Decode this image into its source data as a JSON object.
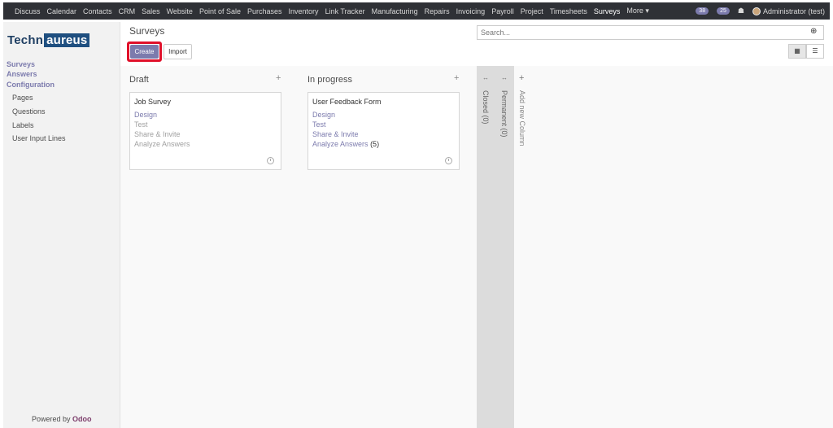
{
  "topbar": {
    "menu": [
      "Discuss",
      "Calendar",
      "Contacts",
      "CRM",
      "Sales",
      "Website",
      "Point of Sale",
      "Purchases",
      "Inventory",
      "Link Tracker",
      "Manufacturing",
      "Repairs",
      "Invoicing",
      "Payroll",
      "Project",
      "Timesheets",
      "Surveys",
      "More ▾"
    ],
    "active_menu": "Surveys",
    "badge_1": "38",
    "badge_2": "25",
    "user": "Administrator (test)"
  },
  "sidebar": {
    "logo_left": "Techn",
    "logo_box": "aureus",
    "items": [
      {
        "label": "Surveys",
        "type": "main"
      },
      {
        "label": "Answers",
        "type": "main"
      },
      {
        "label": "Configuration",
        "type": "main"
      },
      {
        "label": "Pages",
        "type": "sub"
      },
      {
        "label": "Questions",
        "type": "sub"
      },
      {
        "label": "Labels",
        "type": "sub"
      },
      {
        "label": "User Input Lines",
        "type": "sub"
      }
    ],
    "powered_prefix": "Powered by",
    "powered_brand": "Odoo"
  },
  "control": {
    "breadcrumb": "Surveys",
    "create_label": "Create",
    "import_label": "Import",
    "search_placeholder": "Search..."
  },
  "kanban": {
    "columns": [
      {
        "title": "Draft",
        "card": {
          "title": "Job Survey",
          "links": [
            {
              "label": "Design",
              "active": true
            },
            {
              "label": "Test",
              "active": false
            },
            {
              "label": "Share & Invite",
              "active": false
            },
            {
              "label": "Analyze Answers",
              "active": false,
              "count": ""
            }
          ]
        }
      },
      {
        "title": "In progress",
        "card": {
          "title": "User Feedback Form",
          "links": [
            {
              "label": "Design",
              "active": true
            },
            {
              "label": "Test",
              "active": true
            },
            {
              "label": "Share & Invite",
              "active": true
            },
            {
              "label": "Analyze Answers",
              "active": true,
              "count": "(5)"
            }
          ]
        }
      }
    ],
    "folded": [
      "Closed (0)",
      "Permanent (0)"
    ],
    "add_column": "Add new Column"
  }
}
